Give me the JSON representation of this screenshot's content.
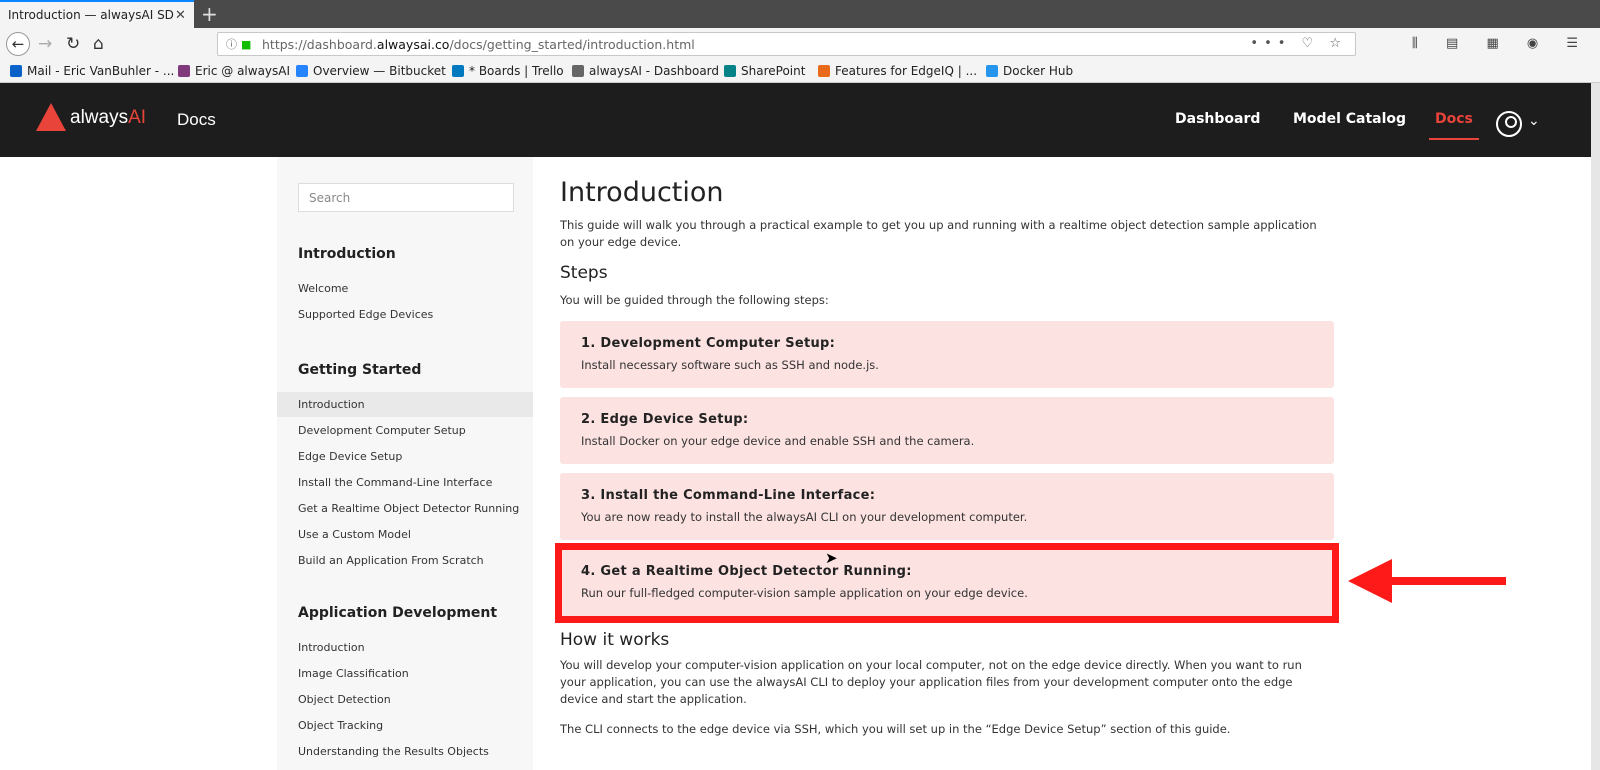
{
  "browser": {
    "tab_title": "Introduction — alwaysAI SD",
    "tab_close": "✕",
    "new_tab": "+",
    "url_prefix": "https://dashboard.",
    "url_host": "alwaysai.co",
    "url_path": "/docs/getting_started/introduction.html",
    "url_right": "••• ♡ ☆",
    "toolbar_right": "⫼ ▤ ▦ ◉ ☰",
    "bookmarks": [
      {
        "label": "Mail - Eric VanBuhler - ...",
        "color": "#0a62c9"
      },
      {
        "label": "Eric @ alwaysAI",
        "color": "#80397b"
      },
      {
        "label": "Overview — Bitbucket",
        "color": "#2684ff"
      },
      {
        "label": "* Boards | Trello",
        "color": "#0079bf"
      },
      {
        "label": "alwaysAI - Dashboard",
        "color": "#666666"
      },
      {
        "label": "SharePoint",
        "color": "#038387"
      },
      {
        "label": "Features for EdgeIQ | ...",
        "color": "#e86a1a"
      },
      {
        "label": "Docker Hub",
        "color": "#2496ed"
      }
    ]
  },
  "header": {
    "logo_prefix": "always",
    "logo_suffix": "AI",
    "docs_label": "Docs",
    "nav": [
      "Dashboard",
      "Model Catalog",
      "Docs"
    ],
    "accent": "#e8443a"
  },
  "sidebar": {
    "search_placeholder": "Search",
    "sections": [
      {
        "title": "Introduction",
        "items": [
          "Welcome",
          "Supported Edge Devices"
        ]
      },
      {
        "title": "Getting Started",
        "items": [
          "Introduction",
          "Development Computer Setup",
          "Edge Device Setup",
          "Install the Command-Line Interface",
          "Get a Realtime Object Detector Running",
          "Use a Custom Model",
          "Build an Application From Scratch"
        ]
      },
      {
        "title": "Application Development",
        "items": [
          "Introduction",
          "Image Classification",
          "Object Detection",
          "Object Tracking",
          "Understanding the Results Objects"
        ]
      }
    ]
  },
  "main": {
    "title": "Introduction",
    "intro": "This guide will walk you through a practical example to get you up and running with a realtime object detection sample application on your edge device.",
    "steps_heading": "Steps",
    "steps_intro": "You will be guided through the following steps:",
    "steps": [
      {
        "title": "1.  Development Computer Setup:",
        "desc": "Install necessary software such as SSH and node.js."
      },
      {
        "title": "2.  Edge Device Setup:",
        "desc": "Install Docker on your edge device and enable SSH and the camera."
      },
      {
        "title": "3.  Install the Command-Line Interface:",
        "desc": "You are now ready to install the alwaysAI CLI on your development computer."
      },
      {
        "title": "4.  Get a Realtime Object Detector Running:",
        "desc": "Run our full-fledged computer-vision sample application on your edge device."
      }
    ],
    "how_heading": "How it works",
    "how_p1": "You will develop your computer-vision application on your local computer, not on the edge device directly. When you want to run your application, you can use the alwaysAI CLI to deploy your application files from your development computer onto the edge device and start the application.",
    "how_p2": "The CLI connects to the edge device via SSH, which you will set up in the “Edge Device Setup” section of this guide."
  }
}
